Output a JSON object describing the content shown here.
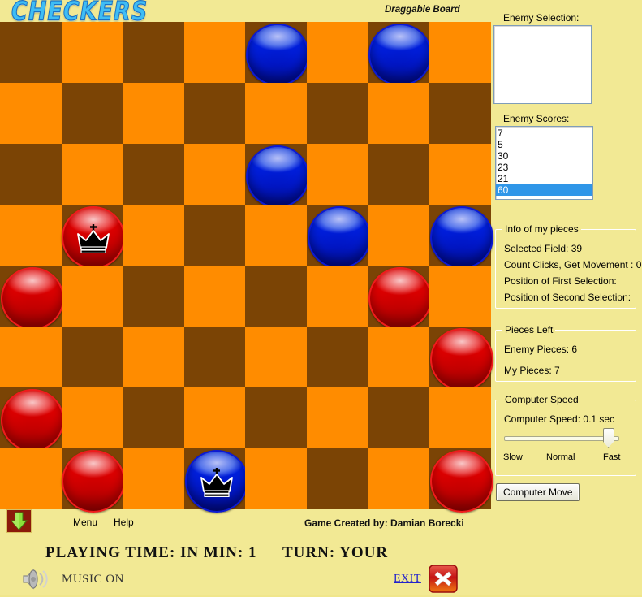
{
  "app": {
    "logo_text": "CHECKERS",
    "draggable_board_label": "Draggable Board"
  },
  "board": {
    "light_color": "#ff8c00",
    "dark_color": "#7b4405",
    "rows": 8,
    "cols": 8,
    "pieces": [
      {
        "row": 0,
        "col": 4,
        "color": "blue",
        "king": false
      },
      {
        "row": 0,
        "col": 6,
        "color": "blue",
        "king": false
      },
      {
        "row": 2,
        "col": 4,
        "color": "blue",
        "king": false
      },
      {
        "row": 3,
        "col": 1,
        "color": "red",
        "king": true
      },
      {
        "row": 3,
        "col": 5,
        "color": "blue",
        "king": false
      },
      {
        "row": 3,
        "col": 7,
        "color": "blue",
        "king": false
      },
      {
        "row": 4,
        "col": 0,
        "color": "red",
        "king": false
      },
      {
        "row": 4,
        "col": 6,
        "color": "red",
        "king": false
      },
      {
        "row": 5,
        "col": 7,
        "color": "red",
        "king": false
      },
      {
        "row": 6,
        "col": 0,
        "color": "red",
        "king": false
      },
      {
        "row": 7,
        "col": 1,
        "color": "red",
        "king": false
      },
      {
        "row": 7,
        "col": 3,
        "color": "blue",
        "king": true
      },
      {
        "row": 7,
        "col": 7,
        "color": "red",
        "king": false
      }
    ]
  },
  "side": {
    "enemy_selection_label": "Enemy Selection:",
    "enemy_selection_items": [],
    "enemy_scores_label": "Enemy Scores:",
    "enemy_scores_items": [
      "7",
      "5",
      "30",
      "23",
      "21",
      "60"
    ],
    "enemy_scores_selected_index": 5,
    "selection_highlight_color": "#2f96e8",
    "info_group": {
      "legend": "Info of my pieces",
      "selected_field": "Selected Field:  39",
      "count_clicks": "Count Clicks, Get Movement : 0",
      "first_selection": "Position of First Selection:",
      "second_selection": "Position of Second Selection:"
    },
    "pieces_left_group": {
      "legend": "Pieces Left",
      "enemy_pieces": "Enemy Pieces:  6",
      "my_pieces": "My Pieces: 7"
    },
    "computer_speed_group": {
      "legend": "Computer Speed",
      "value_label": "Computer Speed: 0.1 sec",
      "slider_percent": 95,
      "tick_slow": "Slow",
      "tick_normal": "Normal",
      "tick_fast": "Fast"
    },
    "computer_move_button": "Computer Move"
  },
  "bottom": {
    "menu_label": "Menu",
    "help_label": "Help",
    "credit": "Game Created by: Damian Borecki",
    "playing_time": "PLAYING  TIME:  IN MIN: 1",
    "turn": "TURN:   YOUR",
    "music_label": "MUSIC ON",
    "exit_label": "EXIT"
  }
}
